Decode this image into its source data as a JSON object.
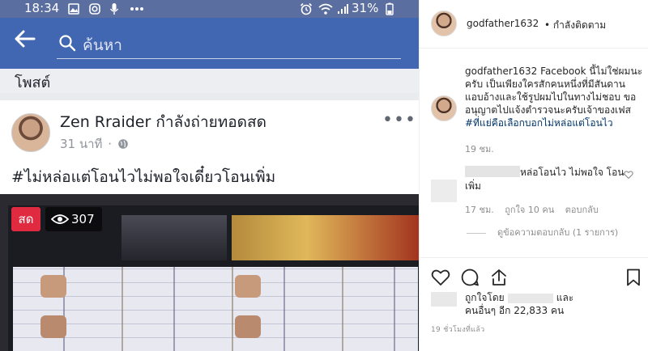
{
  "phone": {
    "status_bar": {
      "time": "18:34",
      "battery": "31%",
      "icons": [
        "image-icon",
        "instagram-icon",
        "mic-icon",
        "more-dots-icon",
        "alarm-icon",
        "wifi-icon",
        "signal-icon"
      ]
    },
    "fb_header": {
      "search_placeholder": "ค้นหา"
    },
    "section_label": "โพสต์",
    "post": {
      "author": "Zen Rraider",
      "action": "กำลังถ่ายทอดสด",
      "time": "31 นาที",
      "text": "#ไม่หล่อแต่โอนไวไม่พอใจเดี๋ยวโอนเพิ่ม",
      "live_label": "สด",
      "viewers": "307"
    },
    "colors": {
      "fb_blue": "#4267b2",
      "live_red": "#e02a3f"
    }
  },
  "instagram": {
    "header": {
      "username": "godfather1632",
      "separator": "•",
      "follow_status": "กำลังติดตาม"
    },
    "caption": {
      "username": "godfather1632",
      "text": "Facebook นี้ไม่ใช่ผมนะครับ เป็นเพียงใครสักคนหนึ่งที่มีสันดานแอบอ้างและใช้รูปผมไปในทางไม่ชอบ ขออนุญาตไปแจ้งตำรวจนะครับเจ้าของเฟส",
      "hashtag": "#ที่แย่คือเลือกบอกไม่หล่อแต่โอนไว",
      "time": "19 ชม."
    },
    "comment": {
      "text_line1": "หล่อโอนไว ไม่พอใจ โอน",
      "text_line2": "เพิ่ม",
      "time": "17 ชม.",
      "likes": "ถูกใจ 10 คน",
      "reply": "ตอบกลับ",
      "view_replies": "ดูข้อความตอบกลับ (1 รายการ)"
    },
    "likes": {
      "prefix": "ถูกใจโดย",
      "and": "และ",
      "others": "คนอื่นๆ อีก 22,833 คน"
    },
    "post_time": "19 ชั่วโมงที่แล้ว"
  }
}
